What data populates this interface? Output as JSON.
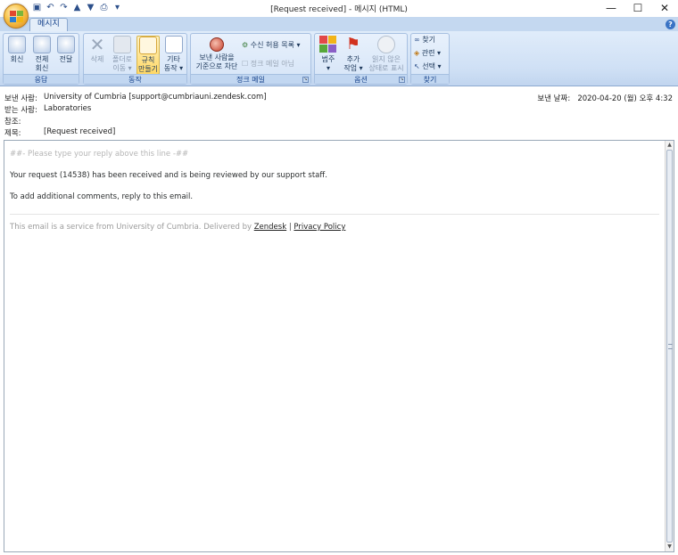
{
  "window": {
    "title": "[Request received] - 메시지 (HTML)",
    "controls": [
      "—",
      "☐",
      "✕"
    ]
  },
  "qat_icons": [
    "save-icon",
    "undo-icon",
    "redo-icon",
    "up-icon",
    "down-icon",
    "print-preview-icon"
  ],
  "tabs": [
    {
      "label": "메시지"
    }
  ],
  "ribbon": {
    "groups": {
      "respond": {
        "label": "응답",
        "buttons": [
          {
            "label1": "회신",
            "label2": ""
          },
          {
            "label1": "전체",
            "label2": "회신"
          },
          {
            "label1": "전달",
            "label2": ""
          }
        ]
      },
      "actions": {
        "label": "동작",
        "buttons": [
          {
            "label1": "삭제",
            "label2": ""
          },
          {
            "label1": "폴더로",
            "label2": "이동 ▾"
          },
          {
            "label1": "규칙",
            "label2": "만들기"
          },
          {
            "label1": "기타",
            "label2": "동작 ▾"
          }
        ]
      },
      "junk": {
        "label": "정크 메일",
        "block_sender": {
          "label1": "보낸 사람을",
          "label2": "기준으로 차단"
        },
        "safe_list": "수신 허용 목록 ▾",
        "not_junk": "정크 메일 아님"
      },
      "options": {
        "label": "옵션",
        "buttons": [
          {
            "label1": "범주",
            "label2": "▾"
          },
          {
            "label1": "추가",
            "label2": "작업 ▾"
          },
          {
            "label1": "읽지 않은",
            "label2": "상태로 표시"
          }
        ]
      },
      "find": {
        "label": "찾기",
        "items": [
          "찾기",
          "관련 ▾",
          "선택 ▾"
        ]
      }
    }
  },
  "header": {
    "from_label": "보낸 사람:",
    "from_value": "University of Cumbria [support@cumbriauni.zendesk.com]",
    "to_label": "받는 사람:",
    "to_value": "Laboratories",
    "cc_label": "참조:",
    "cc_value": "",
    "subject_label": "제목:",
    "subject_value": "[Request received]",
    "sent_label": "보낸 날짜:",
    "sent_value": "2020-04-20 (월) 오후 4:32"
  },
  "body": {
    "reply_line": "##- Please type your reply above this line -##",
    "line1": "Your request (14538) has been received and is being reviewed by our support staff.",
    "line2": "To add additional comments, reply to this email.",
    "footer_prefix": "This email is a service from University of Cumbria. Delivered by",
    "footer_link1": "Zendesk",
    "footer_sep": "|",
    "footer_link2": "Privacy Policy"
  },
  "colors": {
    "ribbon_label": "#15428b",
    "highlight": "#ffd865",
    "frame": "#8ca9cf"
  }
}
